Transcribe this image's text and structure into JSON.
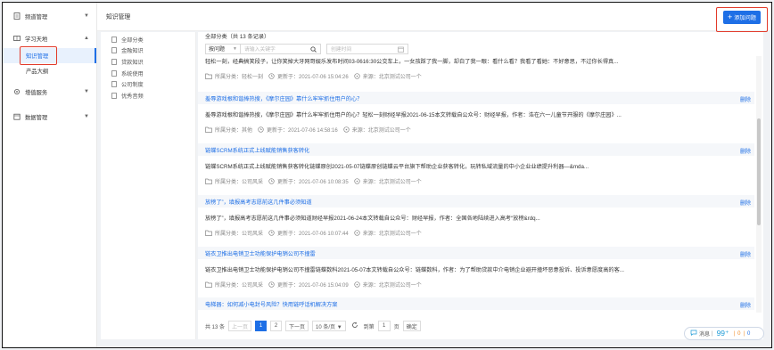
{
  "sidebar": {
    "items": [
      {
        "label": "频道管理",
        "icon": "doc-icon",
        "arrow": "▼"
      },
      {
        "label": "学习天地",
        "icon": "book-icon",
        "arrow": "▲"
      },
      {
        "label": "增值服务",
        "icon": "gear-icon",
        "arrow": "▼"
      },
      {
        "label": "数据管理",
        "icon": "calendar-icon",
        "arrow": "▼"
      }
    ],
    "sub_items": [
      {
        "label": "知识管理",
        "active": true
      },
      {
        "label": "产品大纲",
        "active": false
      }
    ]
  },
  "header": {
    "title": "知识管理",
    "add_button": "添加问题",
    "add_plus": "+"
  },
  "categories": [
    "全部分类",
    "金融知识",
    "贷款知识",
    "系统使用",
    "公司制度",
    "优秀音频"
  ],
  "main": {
    "count_text": "全部分类（共 13 条记录）",
    "filter_select": "按问题",
    "filter_dropdown": "▼",
    "keyword_placeholder": "请输入关键字",
    "date_placeholder": "创建时间"
  },
  "cards": [
    {
      "title": "",
      "body": "轻松一刻，经典搞笑段子，让你笑掉大牙网哥娱乐发布时间03-0616:30公交车上，一女孩踩了我一脚，却白了我一眼：看什么看？我看了看她：不好意思，不过你长得真...",
      "category": "所属分类：轻松一刻",
      "updated": "更新于：2021-07-06 15:04:26",
      "source": "来源：北京测试公司一个",
      "delete": ""
    },
    {
      "title": "羞辱游戏根和谐捧热搜，《摩尔庄园》靠什么牢牢抓住用户的心？",
      "body": "羞辱游戏根和谐捧热搜，《摩尔庄园》靠什么牢牢抓住用户的心？轻松一刻财经早报2021-06-15本文转载自公众号：财经早报，作者：浩在六一儿童节开服的《摩尔庄园》...",
      "category": "所属分类：其他",
      "updated": "更新于：2021-07-06 14:58:16",
      "source": "来源：北京测试公司一个",
      "delete": "删除"
    },
    {
      "title": "链蝶SCRM系统正式上线赋能销售获客转化",
      "body": "链蝶SCRM系统正式上线赋能销售获客转化链蝶原创2021-05-07链蝶原创链蝶云平台旗下帮助企业获客转化，玩转私域流量的中小企业业绩提升利器—&mda...",
      "category": "所属分类：公司风采",
      "updated": "更新于：2021-07-06 10:08:35",
      "source": "来源：北京测试公司一个",
      "delete": "删除"
    },
    {
      "title": "放榜了”，填报高考志愿前这几件事必须知道",
      "body": "放榜了”，填报高考志愿前这几件事必须知道财经早报2021-06-24本文转载自公众号：财经早报，作者：全国各地陆续进入高考“放榜&rdq...",
      "category": "所属分类：公司风采",
      "updated": "更新于：2021-07-06 10:07:44",
      "source": "来源：北京测试公司一个",
      "delete": "删除"
    },
    {
      "title": "链衣卫推出电销卫士功能保护电销公司不撞雷",
      "body": "链衣卫推出电销卫士功能保护电销公司不撞雷链蝶数科2021-05-07本文转载自公众号：链蝶数科，作者：为了帮助贷款中介电销企业避开撞坏恶意投诉、投诉意愿度高的客...",
      "category": "所属分类：公司风采",
      "updated": "更新于：2021-07-06 15:04:09",
      "source": "来源：北京测试公司一个",
      "delete": "删除"
    },
    {
      "title": "电梯器：如何减小电封号风险？快用链呼话机解决方案",
      "body": "",
      "category": "",
      "updated": "",
      "source": "",
      "delete": "删除"
    }
  ],
  "pager": {
    "total": "共 13 条",
    "prev": "上一页",
    "page1": "1",
    "page2": "2",
    "next": "下一页",
    "size": "10 条/页 ▼",
    "goto_label": "到第",
    "goto_value": "1",
    "page_unit": "页",
    "confirm": "确定"
  },
  "chat": {
    "label": "消息",
    "count": "99⁺",
    "sep1": "|",
    "v1": "0",
    "sep2": "|",
    "v2": "0"
  },
  "colors": {
    "accent": "#1e6fe6",
    "highlight_box": "#e23a2a",
    "title_bar_bg": "#f5f7fa"
  }
}
